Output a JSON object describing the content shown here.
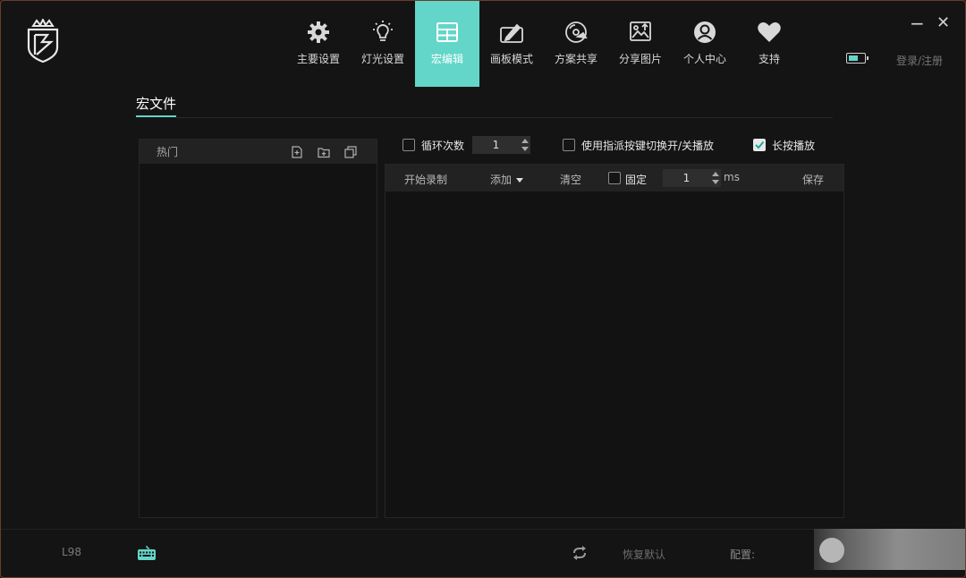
{
  "nav": [
    {
      "label": "主要设置",
      "icon": "gear-icon"
    },
    {
      "label": "灯光设置",
      "icon": "lightbulb-icon"
    },
    {
      "label": "宏编辑",
      "icon": "table-icon",
      "active": true
    },
    {
      "label": "画板模式",
      "icon": "drawing-board-icon"
    },
    {
      "label": "方案共享",
      "icon": "disc-share-icon"
    },
    {
      "label": "分享图片",
      "icon": "image-share-icon"
    },
    {
      "label": "个人中心",
      "icon": "user-circle-icon"
    },
    {
      "label": "支持",
      "icon": "heart-icon"
    }
  ],
  "window": {
    "minimize": "−",
    "close": "✕"
  },
  "header": {
    "login": "登录/注册",
    "battery_level": 0.6
  },
  "section": {
    "title": "宏文件"
  },
  "left_panel": {
    "header": "热门"
  },
  "options": {
    "loop_label": "循环次数",
    "loop_value": "1",
    "loop_checked": false,
    "assign_label": "使用指派按键切换开/关播放",
    "assign_checked": false,
    "longpress_label": "长按播放",
    "longpress_checked": true
  },
  "toolbar": {
    "record": "开始录制",
    "add": "添加",
    "clear": "清空",
    "fixed_label": "固定",
    "fixed_checked": false,
    "delay_value": "1",
    "delay_unit": "ms",
    "save": "保存"
  },
  "footer": {
    "model": "L98",
    "restore": "恢复默认",
    "config": "配置:"
  },
  "colors": {
    "accent": "#63d6c9",
    "background": "#141414",
    "panel": "#222222"
  }
}
